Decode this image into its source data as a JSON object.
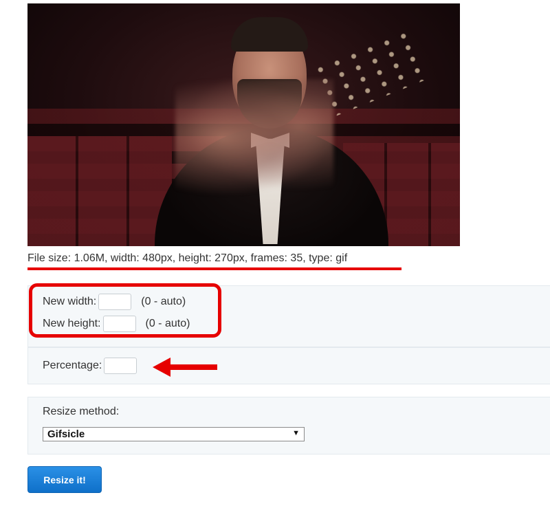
{
  "preview": {
    "alt_name": "gif-preview-image"
  },
  "file_info": {
    "text": "File size: 1.06M, width: 480px, height: 270px, frames: 35, type: gif"
  },
  "size_form": {
    "width_label": "New width:",
    "width_value": "",
    "width_hint": "(0 - auto)",
    "height_label": "New height:",
    "height_value": "",
    "height_hint": "(0 - auto)",
    "percentage_label": "Percentage:",
    "percentage_value": ""
  },
  "method": {
    "label": "Resize method:",
    "selected": "Gifsicle"
  },
  "submit": {
    "label": "Resize it!"
  },
  "colors": {
    "annotation_red": "#e60000",
    "button_blue": "#1a7fd9",
    "panel_bg": "#f5f8fa"
  },
  "icons": {
    "select_chevron": "chevron-down-icon",
    "annotation_arrow": "left-arrow-icon"
  }
}
